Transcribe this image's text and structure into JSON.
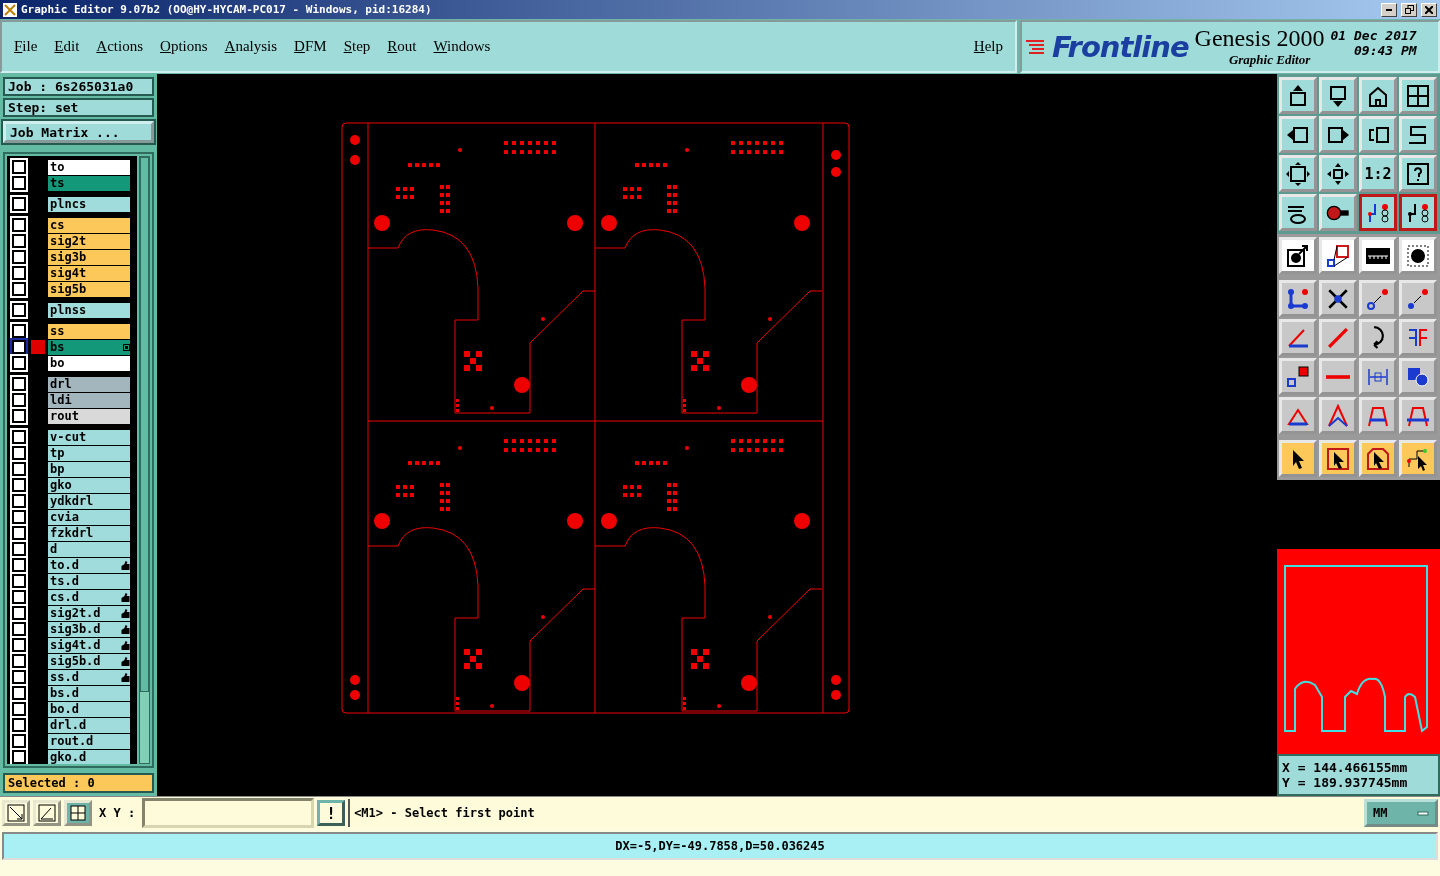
{
  "window": {
    "title": "Graphic Editor 9.07b2 (OO@HY-HYCAM-PC017 - Windows, pid:16284)"
  },
  "menu": {
    "items": [
      "File",
      "Edit",
      "Actions",
      "Options",
      "Analysis",
      "DFM",
      "Step",
      "Rout",
      "Windows"
    ],
    "help": "Help"
  },
  "brand": {
    "logo": "Frontline",
    "product": "Genesis 2000",
    "subtitle": "Graphic Editor",
    "date": "01 Dec 2017",
    "time": "09:43 PM"
  },
  "job": {
    "job": "Job : 6s265031a0",
    "step": "Step: set",
    "matrix_button": "Job Matrix ...",
    "selected": "Selected : 0"
  },
  "layer_groups": [
    [
      {
        "name": "to",
        "color": "#ffffff",
        "kind": "plain",
        "checked": false,
        "work": false
      },
      {
        "name": "ts",
        "color": "#13997a",
        "kind": "plain",
        "checked": false,
        "work": false
      }
    ],
    [
      {
        "name": "plncs",
        "color": "#a0dcdc",
        "kind": "plain",
        "checked": false,
        "work": false
      }
    ],
    [
      {
        "name": "cs",
        "color": "#fdc85a",
        "kind": "plain",
        "checked": false,
        "work": false
      },
      {
        "name": "sig2t",
        "color": "#fdc85a",
        "kind": "plain",
        "checked": false,
        "work": false
      },
      {
        "name": "sig3b",
        "color": "#fdc85a",
        "kind": "plain",
        "checked": false,
        "work": false
      },
      {
        "name": "sig4t",
        "color": "#fdc85a",
        "kind": "plain",
        "checked": false,
        "work": false
      },
      {
        "name": "sig5b",
        "color": "#fdc85a",
        "kind": "plain",
        "checked": false,
        "work": false
      }
    ],
    [
      {
        "name": "plnss",
        "color": "#a0dcdc",
        "kind": "plain",
        "checked": false,
        "work": false
      }
    ],
    [
      {
        "name": "ss",
        "color": "#fdc85a",
        "kind": "plain",
        "checked": false,
        "work": false
      },
      {
        "name": "bs",
        "color": "#13997a",
        "kind": "grid",
        "checked": false,
        "work": true
      },
      {
        "name": "bo",
        "color": "#ffffff",
        "kind": "plain",
        "checked": false,
        "work": false
      }
    ],
    [
      {
        "name": "drl",
        "color": "#a3b6bd",
        "kind": "plain",
        "checked": false,
        "work": false
      },
      {
        "name": "ldi",
        "color": "#a3b6bd",
        "kind": "plain",
        "checked": false,
        "work": false
      },
      {
        "name": "rout",
        "color": "#d9d9d9",
        "kind": "plain",
        "checked": false,
        "work": false
      }
    ],
    [
      {
        "name": "v-cut",
        "color": "#a0dcdc",
        "kind": "plain",
        "checked": false,
        "work": false
      },
      {
        "name": "tp",
        "color": "#a0dcdc",
        "kind": "plain",
        "checked": false,
        "work": false
      },
      {
        "name": "bp",
        "color": "#a0dcdc",
        "kind": "plain",
        "checked": false,
        "work": false
      },
      {
        "name": "gko",
        "color": "#a0dcdc",
        "kind": "plain",
        "checked": false,
        "work": false
      },
      {
        "name": "ydkdrl",
        "color": "#a0dcdc",
        "kind": "plain",
        "checked": false,
        "work": false
      },
      {
        "name": "cvia",
        "color": "#a0dcdc",
        "kind": "plain",
        "checked": false,
        "work": false
      },
      {
        "name": "fzkdrl",
        "color": "#a0dcdc",
        "kind": "plain",
        "checked": false,
        "work": false
      },
      {
        "name": "d",
        "color": "#a0dcdc",
        "kind": "plain",
        "checked": false,
        "work": false
      },
      {
        "name": "to.d",
        "color": "#a0dcdc",
        "kind": "hand",
        "checked": false,
        "work": false
      },
      {
        "name": "ts.d",
        "color": "#a0dcdc",
        "kind": "plain",
        "checked": false,
        "work": false
      },
      {
        "name": "cs.d",
        "color": "#a0dcdc",
        "kind": "hand",
        "checked": false,
        "work": false
      },
      {
        "name": "sig2t.d",
        "color": "#a0dcdc",
        "kind": "hand",
        "checked": false,
        "work": false
      },
      {
        "name": "sig3b.d",
        "color": "#a0dcdc",
        "kind": "hand",
        "checked": false,
        "work": false
      },
      {
        "name": "sig4t.d",
        "color": "#a0dcdc",
        "kind": "hand",
        "checked": false,
        "work": false
      },
      {
        "name": "sig5b.d",
        "color": "#a0dcdc",
        "kind": "hand",
        "checked": false,
        "work": false
      },
      {
        "name": "ss.d",
        "color": "#a0dcdc",
        "kind": "hand",
        "checked": false,
        "work": false
      },
      {
        "name": "bs.d",
        "color": "#a0dcdc",
        "kind": "plain",
        "checked": false,
        "work": false
      },
      {
        "name": "bo.d",
        "color": "#a0dcdc",
        "kind": "plain",
        "checked": false,
        "work": false
      },
      {
        "name": "drl.d",
        "color": "#a0dcdc",
        "kind": "plain",
        "checked": false,
        "work": false
      },
      {
        "name": "rout.d",
        "color": "#a0dcdc",
        "kind": "plain",
        "checked": false,
        "work": false
      },
      {
        "name": "gko.d",
        "color": "#a0dcdc",
        "kind": "plain",
        "checked": false,
        "work": false
      }
    ]
  ],
  "tools": {
    "view": [
      {
        "selected": false
      },
      {
        "selected": false
      },
      {
        "selected": false
      },
      {
        "selected": false
      },
      {
        "selected": false
      },
      {
        "selected": false
      },
      {
        "selected": false
      },
      {
        "selected": false
      },
      {
        "selected": false
      },
      {
        "selected": false
      },
      {
        "selected": false,
        "label": "1:2"
      },
      {
        "selected": false
      },
      {
        "selected": false
      },
      {
        "selected": false
      },
      {
        "selected": true
      },
      {
        "selected": true
      }
    ],
    "mode": [
      {
        "selected": false
      },
      {
        "selected": false
      },
      {
        "selected": false
      },
      {
        "selected": false
      }
    ],
    "edit": [
      {
        "selected": false
      },
      {
        "selected": false
      },
      {
        "selected": false
      },
      {
        "selected": false
      },
      {
        "selected": false
      },
      {
        "selected": false
      },
      {
        "selected": false
      },
      {
        "selected": false
      },
      {
        "selected": false
      },
      {
        "selected": false
      },
      {
        "selected": false
      },
      {
        "selected": false
      },
      {
        "selected": false
      },
      {
        "selected": false
      },
      {
        "selected": false
      },
      {
        "selected": false
      }
    ],
    "select": [
      {
        "selected": false
      },
      {
        "selected": false
      },
      {
        "selected": false
      },
      {
        "selected": false
      }
    ]
  },
  "coordinates": {
    "x": "X = 144.466155mm",
    "y": "Y = 189.937745mm"
  },
  "command_bar": {
    "xy_label": "X Y :",
    "action": "!",
    "prompt": "<M1> - Select first point",
    "units": "MM"
  },
  "status_bar": "DX=-5,DY=-49.7858,D=50.036245"
}
